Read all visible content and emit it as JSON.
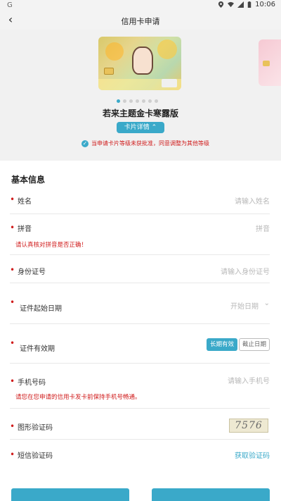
{
  "status_bar": {
    "time": "10:06",
    "left_indicator": "G"
  },
  "nav": {
    "title": "信用卡申请"
  },
  "hero": {
    "card_name": "若来主题金卡寒露版",
    "detail_label": "卡片详情",
    "detail_chevron": "⌃",
    "notice": "当申请卡片等级未获批准，同意调整为其他等级",
    "dot_count": 7,
    "active_dot": 0
  },
  "form": {
    "section_title": "基本信息",
    "name": {
      "label": "姓名",
      "placeholder": "请输入姓名"
    },
    "pinyin": {
      "label": "拼音",
      "placeholder": "拼音",
      "hint": "请认真核对拼音是否正确！"
    },
    "id_number": {
      "label": "身份证号",
      "placeholder": "请输入身份证号"
    },
    "id_start": {
      "label": "证件起始日期",
      "placeholder": "开始日期"
    },
    "id_valid": {
      "label": "证件有效期",
      "option_long": "长期有效",
      "option_end": "截止日期"
    },
    "phone": {
      "label": "手机号码",
      "placeholder": "请输入手机号",
      "hint": "请您在您申请的信用卡发卡前保持手机号畅通。"
    },
    "captcha": {
      "label": "图形验证码",
      "code": "7576"
    },
    "sms": {
      "label": "短信验证码",
      "link": "获取验证码"
    }
  },
  "colors": {
    "accent": "#3aa9c9",
    "required": "#d01c1c"
  }
}
